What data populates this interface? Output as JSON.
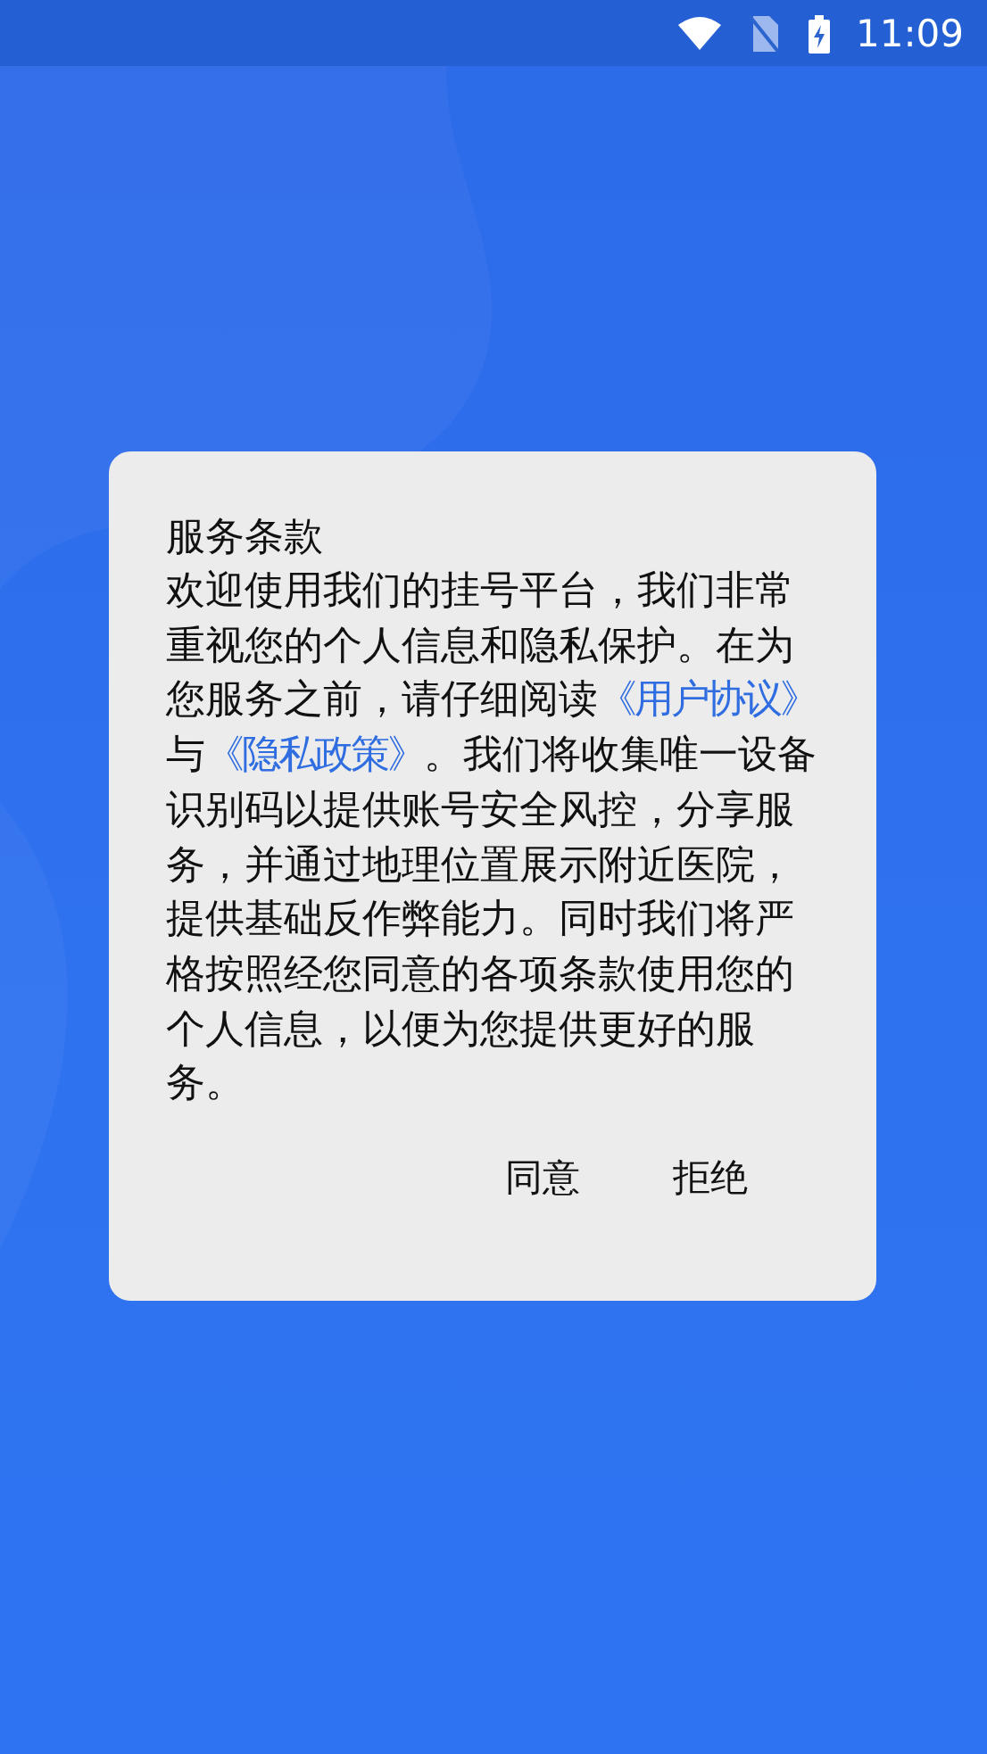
{
  "status_bar": {
    "time": "11:09"
  },
  "dialog": {
    "title": "服务条款",
    "body": [
      {
        "kind": "text",
        "text": "欢迎使用我们的挂号平台，我们非常重视您的个人信息和隐私保护。在为您服务之前，请仔细阅读"
      },
      {
        "kind": "link",
        "text": "《用户协议》"
      },
      {
        "kind": "text",
        "text": "与"
      },
      {
        "kind": "link",
        "text": "《隐私政策》"
      },
      {
        "kind": "text",
        "text": "。我们将收集唯一设备识别码以提供账号安全风控，分享服务，并通过地理位置展示附近医院，提供基础反作弊能力。同时我们将严格按照经您同意的各项条款使用您的个人信息，以便为您提供更好的服务。"
      }
    ],
    "buttons": [
      "同意",
      "拒绝"
    ]
  }
}
